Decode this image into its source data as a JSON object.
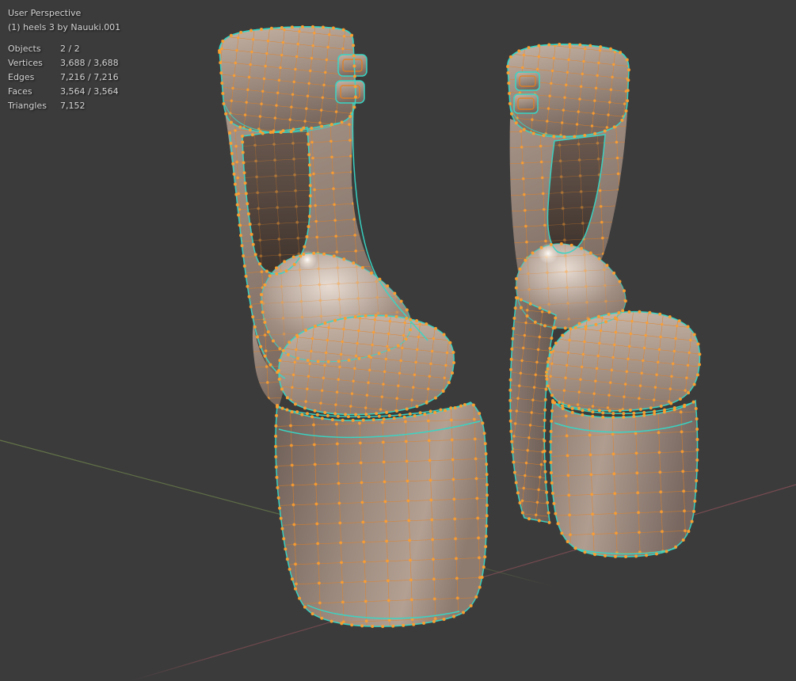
{
  "viewport": {
    "view_label": "User Perspective",
    "active_object_label": "(1) heels 3 by Nauuki.001",
    "stats": [
      {
        "label": "Objects",
        "value": "2 / 2"
      },
      {
        "label": "Vertices",
        "value": "3,688 / 3,688"
      },
      {
        "label": "Edges",
        "value": "7,216 / 7,216"
      },
      {
        "label": "Faces",
        "value": "3,564 / 3,564"
      },
      {
        "label": "Triangles",
        "value": "7,152"
      }
    ]
  },
  "colors": {
    "background": "#3b3b3b",
    "hud_text": "#d6d6d6",
    "wireframe_orange": "#e87e1a",
    "vertex_orange": "#ff9e2c",
    "selected_edge_cyan": "#37d6c5",
    "axis_x_red": "#a05560",
    "axis_y_green": "#7e9a50",
    "mesh_light": "#c4b2a4",
    "mesh_mid": "#93827a",
    "mesh_dark": "#4a3e37"
  }
}
